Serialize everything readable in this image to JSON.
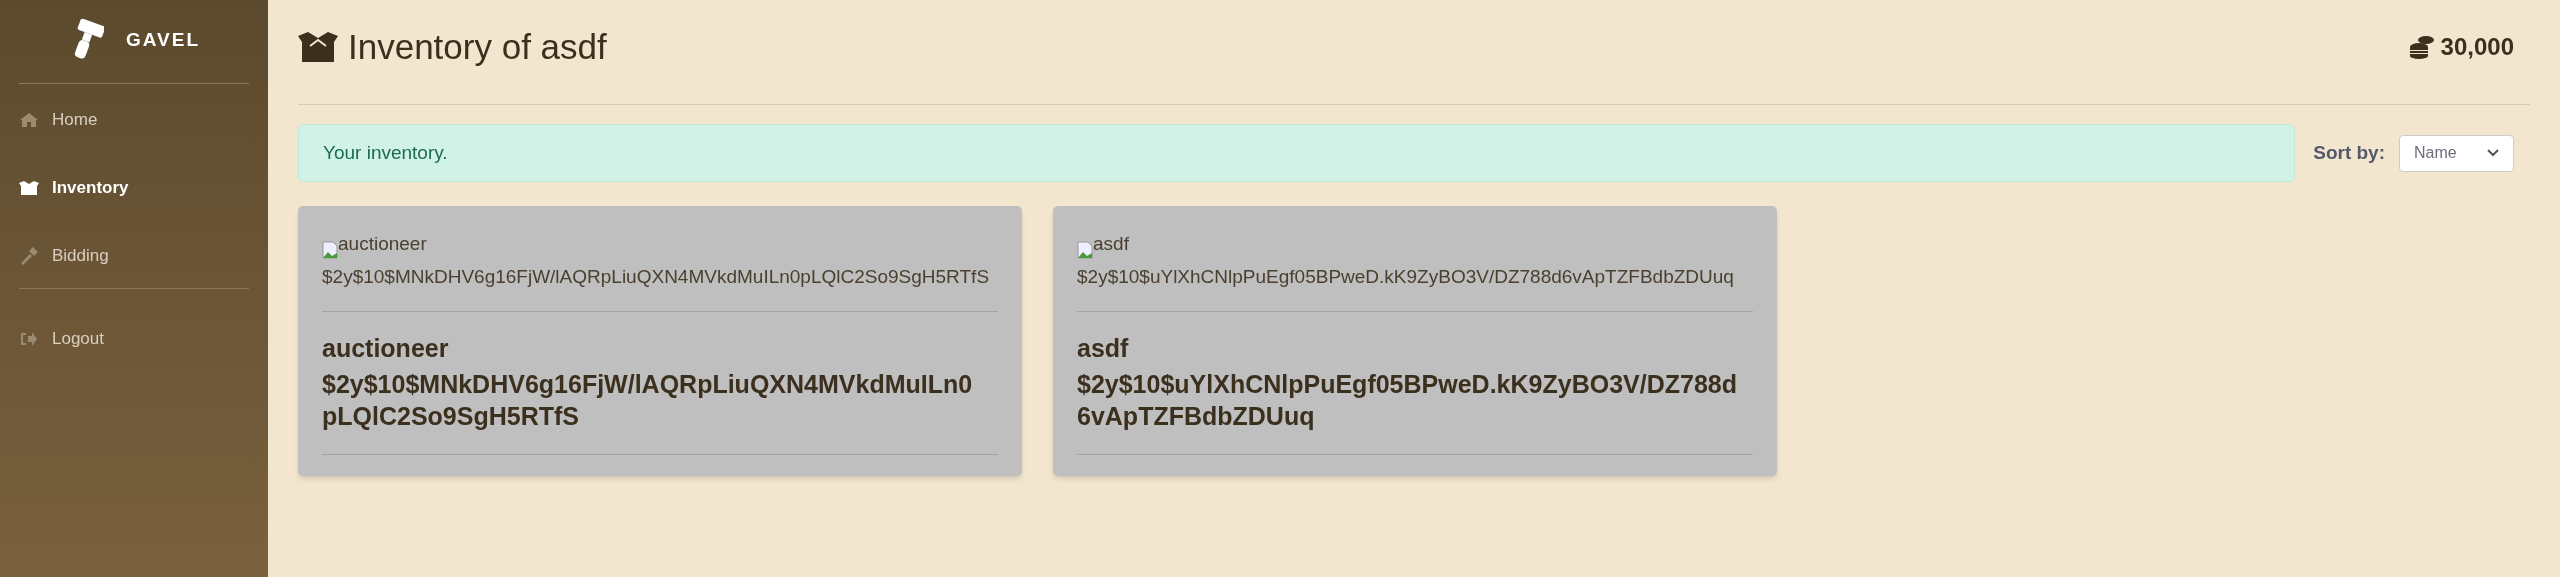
{
  "sidebar": {
    "brand": "GAVEL",
    "items": [
      {
        "label": "Home",
        "selected": false
      },
      {
        "label": "Inventory",
        "selected": true
      },
      {
        "label": "Bidding",
        "selected": false
      }
    ],
    "footer_items": [
      {
        "label": "Logout",
        "selected": false
      }
    ]
  },
  "header": {
    "title": "Inventory of asdf",
    "balance": "30,000"
  },
  "alert": "Your inventory.",
  "sort": {
    "label": "Sort by:",
    "value": "Name"
  },
  "cards": [
    {
      "image_alt": "auctioneer",
      "image_alt_hash": "$2y$10$MNkDHV6g16FjW/lAQRpLiuQXN4MVkdMuILn0pLQlC2So9SgH5RTfS",
      "name": "auctioneer",
      "hash": "$2y$10$MNkDHV6g16FjW/lAQRpLiuQXN4MVkdMuILn0pLQlC2So9SgH5RTfS"
    },
    {
      "image_alt": "asdf",
      "image_alt_hash": "$2y$10$uYlXhCNlpPuEgf05BPweD.kK9ZyBO3V/DZ788d6vApTZFBdbZDUuq",
      "name": "asdf",
      "hash": "$2y$10$uYlXhCNlpPuEgf05BPweD.kK9ZyBO3V/DZ788d6vApTZFBdbZDUuq"
    }
  ]
}
